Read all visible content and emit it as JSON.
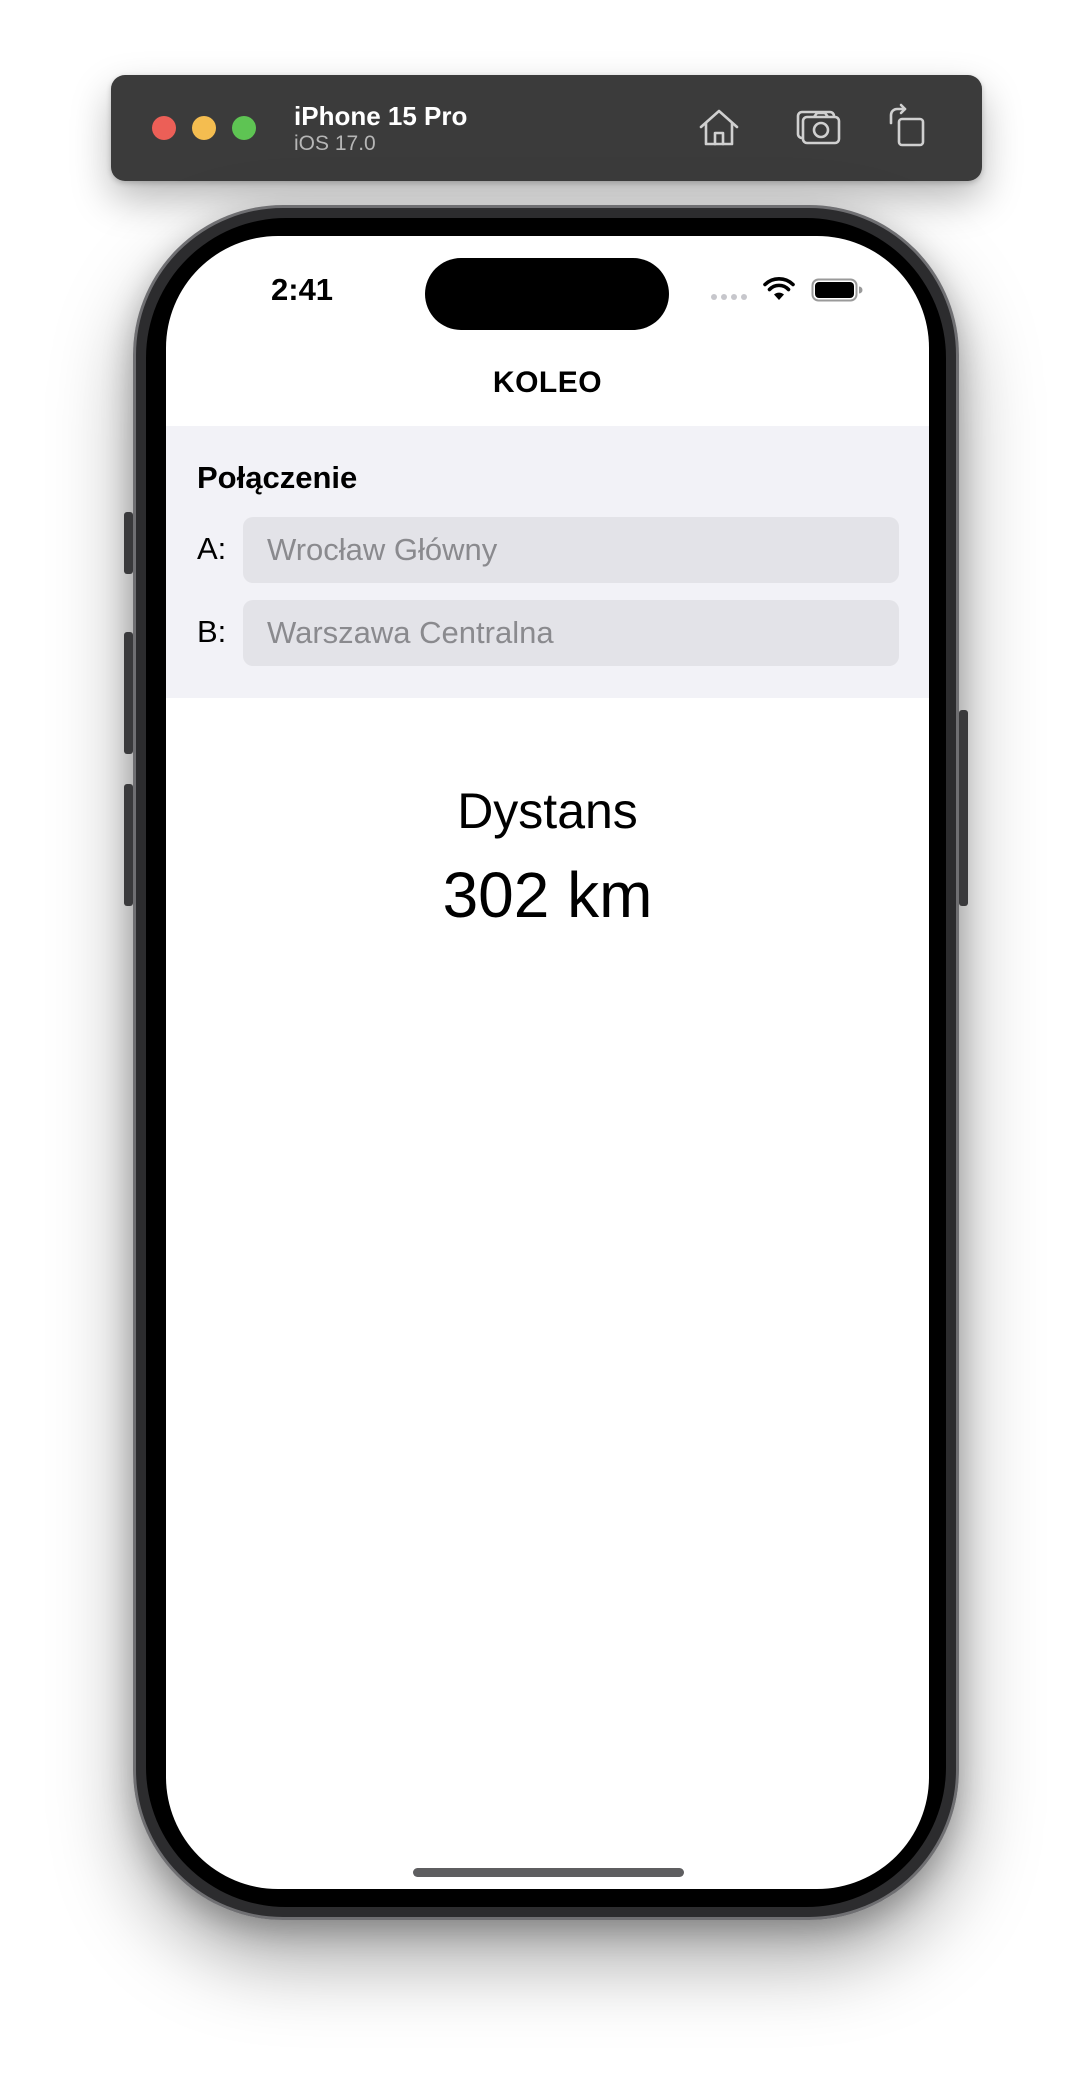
{
  "simulator": {
    "device_name": "iPhone 15 Pro",
    "os_version": "iOS 17.0",
    "icons": [
      "home-icon",
      "screenshot-icon",
      "rotate-icon"
    ]
  },
  "status_bar": {
    "time": "2:41",
    "icons": [
      "cellular-signal-icon",
      "wifi-icon",
      "battery-icon"
    ]
  },
  "nav": {
    "title": "KOLEO"
  },
  "connection": {
    "header": "Połączenie",
    "fields": [
      {
        "label": "A:",
        "value": "",
        "placeholder": "Wrocław Główny"
      },
      {
        "label": "B:",
        "value": "",
        "placeholder": "Warszawa Centralna"
      }
    ]
  },
  "distance": {
    "label": "Dystans",
    "value": "302 km"
  },
  "colors": {
    "section_background": "#f2f2f7",
    "field_background": "#e3e3e8",
    "placeholder": "#8a8a8e"
  }
}
